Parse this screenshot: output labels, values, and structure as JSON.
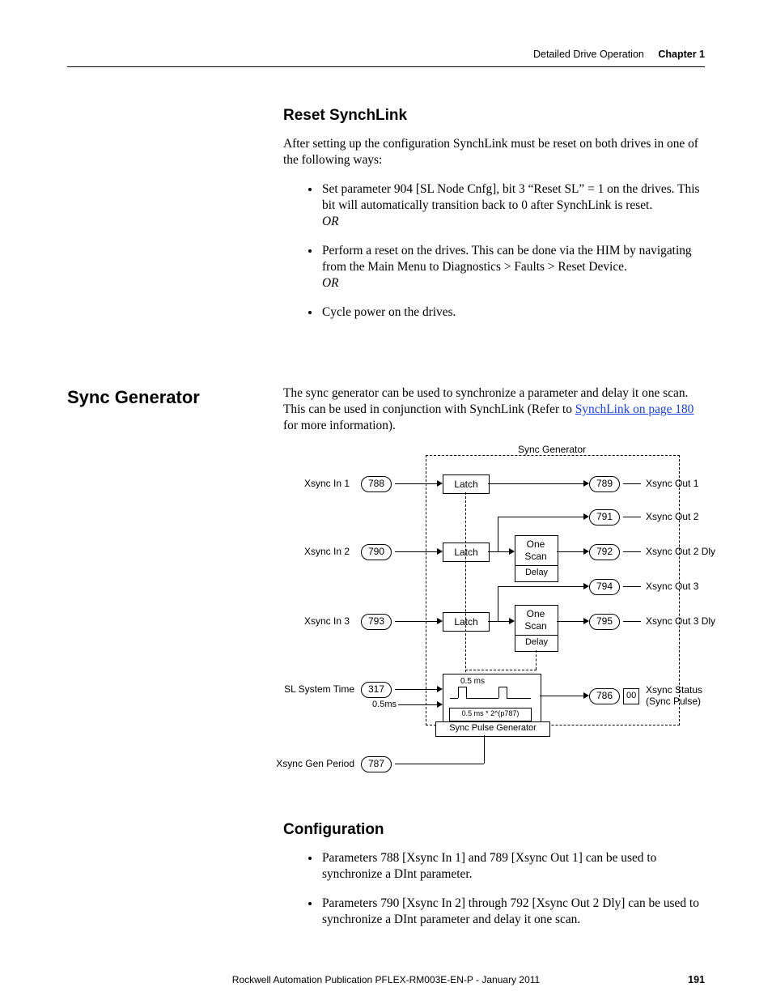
{
  "header": {
    "section": "Detailed Drive Operation",
    "chapter": "Chapter 1"
  },
  "footer": {
    "publication": "Rockwell Automation Publication PFLEX-RM003E-EN-P - January 2011",
    "page": "191"
  },
  "reset": {
    "heading": "Reset SynchLink",
    "intro": "After setting up the configuration SynchLink must be reset on both drives in one of the following ways:",
    "b1a": "Set parameter 904 [SL Node Cnfg], bit 3 “Reset SL” = 1 on the drives. This bit will automatically transition back to 0 after SynchLink is reset.",
    "or1": "OR",
    "b2a": "Perform a reset on the drives. This can be done via the HIM by navigating from the Main Menu to Diagnostics > Faults > Reset Device.",
    "or2": "OR",
    "b3a": "Cycle power on the drives."
  },
  "sync": {
    "sideheading": "Sync Generator",
    "p1_a": "The sync generator can be used to synchronize a parameter and delay it one scan. This can be used in conjunction with SynchLink (Refer to ",
    "p1_link": "SynchLink on page 180",
    "p1_b": " for more information)."
  },
  "diagram": {
    "title": "Sync Generator",
    "in1_lbl": "Xsync In 1",
    "in1_p": "788",
    "in2_lbl": "Xsync In 2",
    "in2_p": "790",
    "in3_lbl": "Xsync In 3",
    "in3_p": "793",
    "latch": "Latch",
    "delay_box_a": "One",
    "delay_box_b": "Scan",
    "delay_box_c": "Delay",
    "out1_p": "789",
    "out1_lbl": "Xsync Out 1",
    "out2_p": "791",
    "out2_lbl": "Xsync Out 2",
    "out2d_p": "792",
    "out2d_lbl": "Xsync Out 2 Dly",
    "out3_p": "794",
    "out3_lbl": "Xsync Out 3",
    "out3d_p": "795",
    "out3d_lbl": "Xsync Out 3 Dly",
    "sltime_lbl": "SL System Time",
    "sltime_p": "317",
    "half_ms": "0.5ms",
    "half_ms2": "0.5 ms",
    "mult_expr": "0.5 ms * 2^(p787)",
    "pulse_gen": "Sync Pulse Generator",
    "xstat_p": "786",
    "xstat_bit": "00",
    "xstat_lbl_a": "Xsync Status",
    "xstat_lbl_b": "(Sync Pulse)",
    "period_lbl": "Xsync Gen Period",
    "period_p": "787"
  },
  "cfg": {
    "heading": "Configuration",
    "b1": "Parameters 788 [Xsync In 1] and 789 [Xsync Out 1] can be used to synchronize a DInt parameter.",
    "b2": "Parameters 790 [Xsync In 2] through 792 [Xsync Out 2 Dly] can be used to synchronize a DInt parameter and delay it one scan."
  }
}
